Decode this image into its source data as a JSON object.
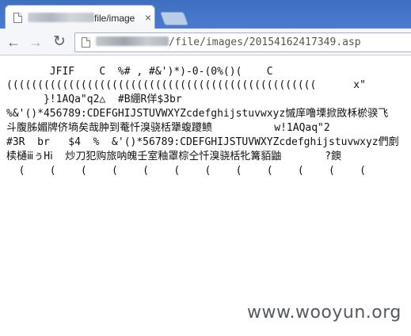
{
  "tab": {
    "title_suffix": "file/image",
    "close_glyph": "×"
  },
  "toolbar": {
    "back_glyph": "←",
    "forward_glyph": "→",
    "reload_glyph": "↻"
  },
  "address": {
    "path": "/file/images/20154162417349.asp"
  },
  "content": {
    "lines": [
      "       JFIF    C  %# , #&')*)-0-(0%()(    C",
      "((((((((((((((((((((((((((((((((((((((((((((((((((      x\"",
      "      }!1AQa\"q2△  #B綳R佯$3br",
      "%&'()*456789:CDEFGHIJSTUVWXYZcdefghijstuvwxyz慽庠噜塛掀敃柇棜骙飞",
      "斗腹胏媚牌侪墒矣哉肿到菴忏溴骁栝犟蝮躨鲼          w!1AQaq\"2",
      "#3R  br   $4  %  &'()*56789:CDEFGHIJSTUVWXYZcdefghijstuvwxyz們剫",
      "椟樋ⅲぅHⅰ  炒刀犯购旅呐魄壬室釉罩棕仝忏溴骁栝牝篝貊鼬       ?鐭",
      "  (    (    (    (    (    (    (    (    (    (    (    ("
    ]
  },
  "watermark": {
    "text": "www.wooyun.org"
  }
}
